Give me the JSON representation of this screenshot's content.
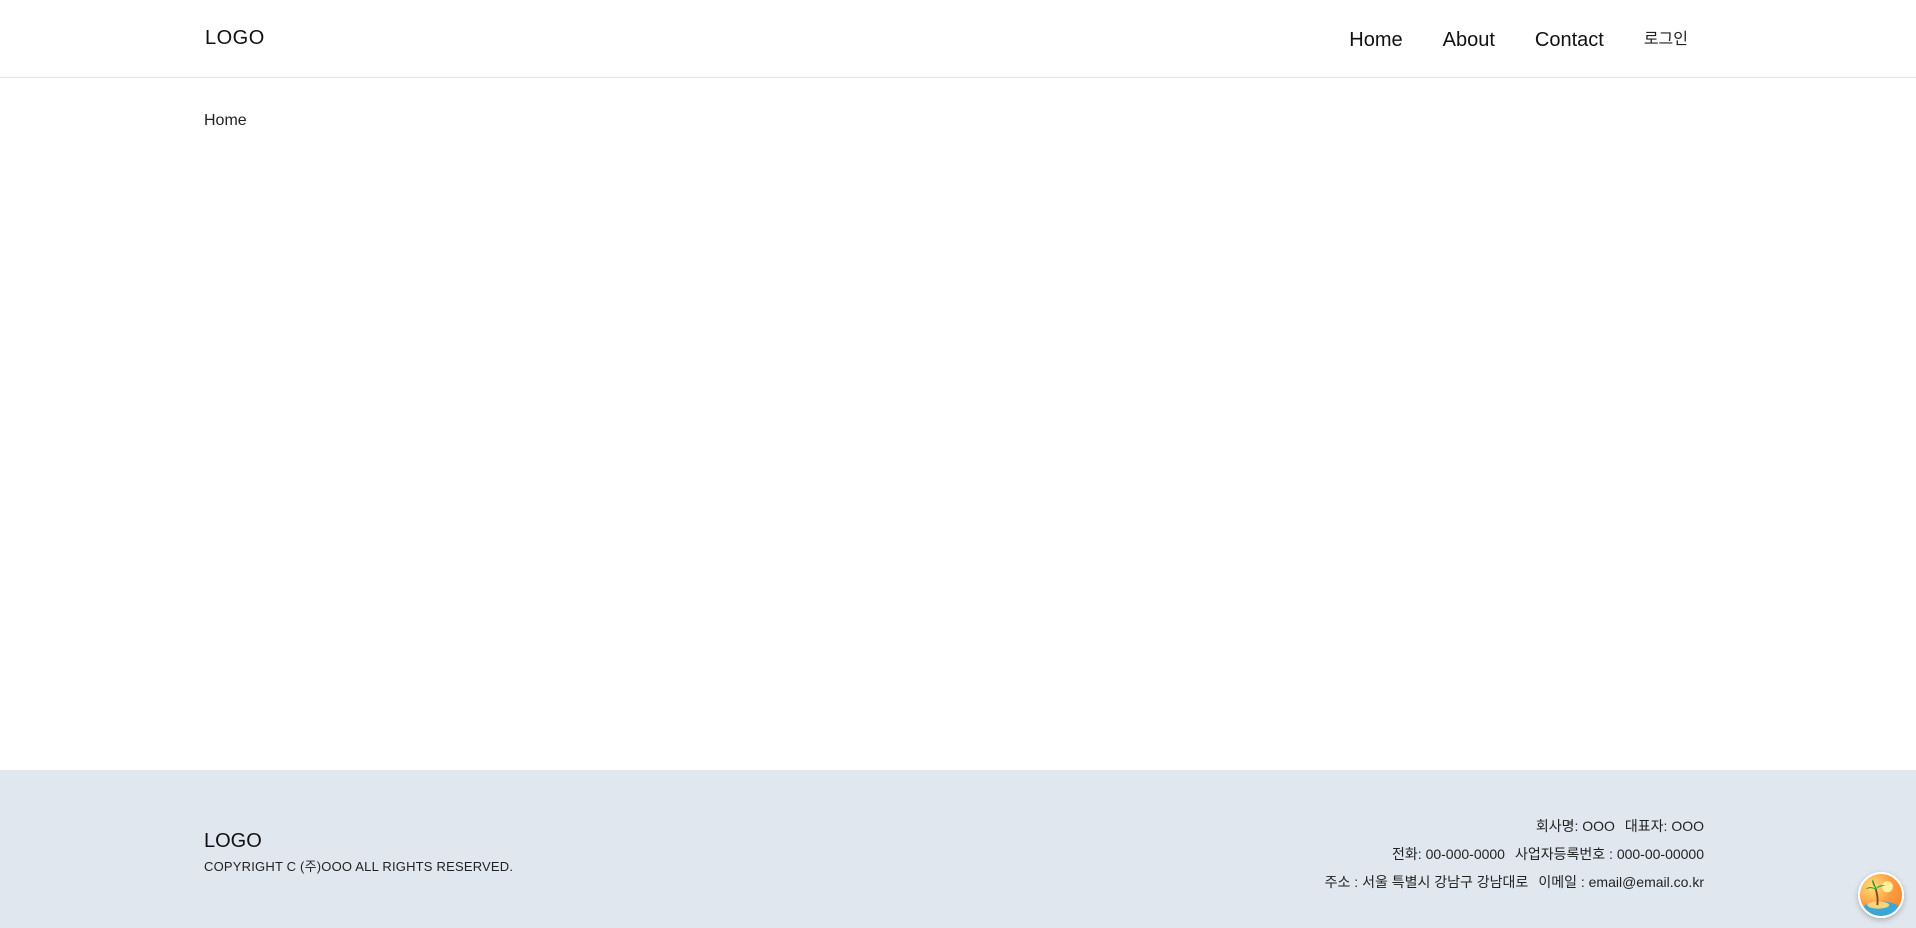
{
  "header": {
    "logo": "LOGO",
    "nav": [
      {
        "label": "Home"
      },
      {
        "label": "About"
      },
      {
        "label": "Contact"
      },
      {
        "label": "로그인"
      }
    ]
  },
  "main": {
    "breadcrumb": "Home"
  },
  "footer": {
    "logo": "LOGO",
    "copyright": "COPYRIGHT C (주)OOO ALL RIGHTS RESERVED.",
    "info": {
      "company": "회사명: OOO",
      "ceo": "대표자: OOO",
      "phone": "전화: 00-000-0000",
      "business_no": "사업자등록번호 : 000-00-00000",
      "address": "주소 : 서울 특별시 강남구 강남대로",
      "email": "이메일 : email@email.co.kr"
    }
  },
  "widget": {
    "icon": "island-palm-icon"
  }
}
